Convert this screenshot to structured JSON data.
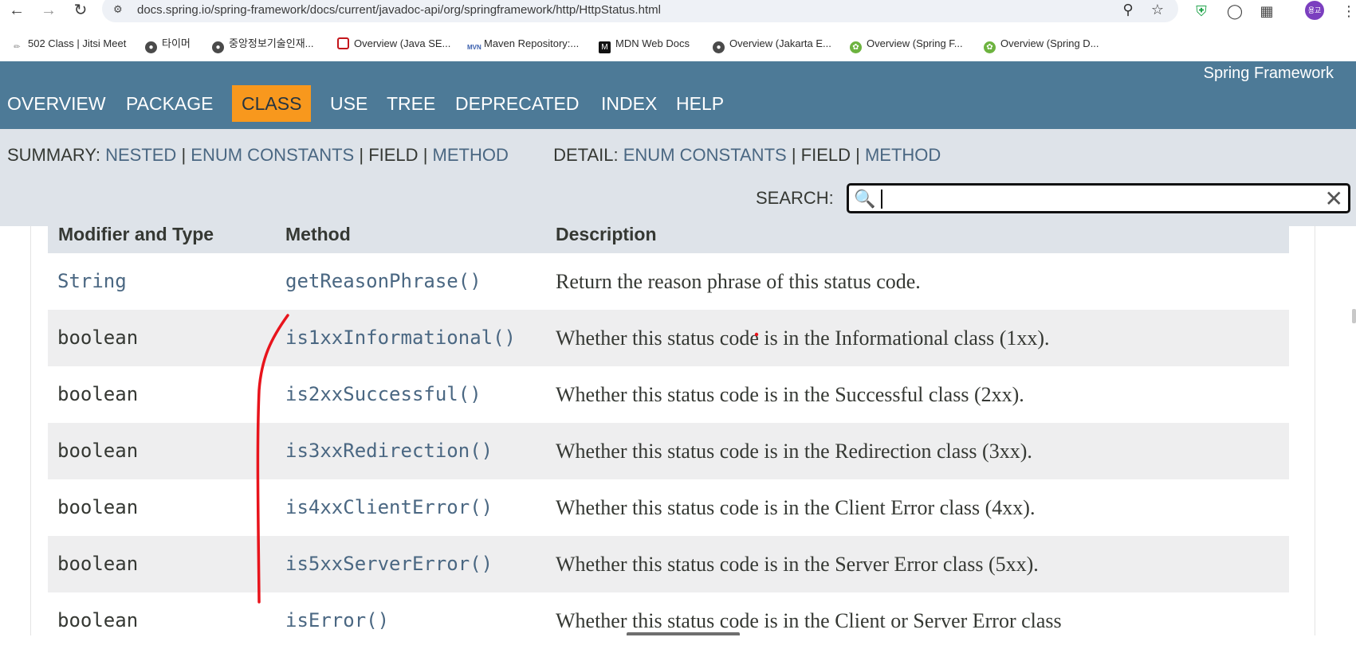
{
  "browser": {
    "url": "docs.spring.io/spring-framework/docs/current/javadoc-api/org/springframework/http/HttpStatus.html",
    "profile_initials": "용교",
    "bookmarks": [
      {
        "label": "502 Class | Jitsi Meet",
        "icon": "jitsi-icon"
      },
      {
        "label": "타이머",
        "icon": "globe-icon"
      },
      {
        "label": "중앙정보기술인재...",
        "icon": "globe-icon"
      },
      {
        "label": "Overview (Java SE...",
        "icon": "oracle-icon"
      },
      {
        "label": "Maven Repository:...",
        "icon": "maven-icon"
      },
      {
        "label": "MDN Web Docs",
        "icon": "mdn-icon"
      },
      {
        "label": "Overview (Jakarta E...",
        "icon": "globe-icon"
      },
      {
        "label": "Overview (Spring F...",
        "icon": "spring-icon"
      },
      {
        "label": "Overview (Spring D...",
        "icon": "spring-icon"
      }
    ]
  },
  "javadoc": {
    "brand": "Spring Framework",
    "nav": [
      "OVERVIEW",
      "PACKAGE",
      "CLASS",
      "USE",
      "TREE",
      "DEPRECATED",
      "INDEX",
      "HELP"
    ],
    "active_nav": "CLASS",
    "summary": {
      "label": "SUMMARY:",
      "nested": "NESTED",
      "enum_constants": "ENUM CONSTANTS",
      "field": "FIELD",
      "method": "METHOD",
      "sep": "|"
    },
    "detail": {
      "label": "DETAIL:",
      "enum_constants": "ENUM CONSTANTS",
      "field": "FIELD",
      "method": "METHOD"
    },
    "search_label": "SEARCH:",
    "search_value": ""
  },
  "method_table": {
    "headers": [
      "Modifier and Type",
      "Method",
      "Description"
    ],
    "rows": [
      {
        "type": "String",
        "method": "getReasonPhrase()",
        "desc": "Return the reason phrase of this status code."
      },
      {
        "type": "boolean",
        "method": "is1xxInformational()",
        "desc": "Whether this status code is in the Informational class (1xx)."
      },
      {
        "type": "boolean",
        "method": "is2xxSuccessful()",
        "desc": "Whether this status code is in the Successful class (2xx)."
      },
      {
        "type": "boolean",
        "method": "is3xxRedirection()",
        "desc": "Whether this status code is in the Redirection class (3xx)."
      },
      {
        "type": "boolean",
        "method": "is4xxClientError()",
        "desc": "Whether this status code is in the Client Error class (4xx)."
      },
      {
        "type": "boolean",
        "method": "is5xxServerError()",
        "desc": "Whether this status code is in the Server Error class (5xx)."
      },
      {
        "type": "boolean",
        "method": "isError()",
        "desc": "Whether this status code is in the Client or Server Error class"
      }
    ]
  },
  "colors": {
    "header_bg": "#4d7a97",
    "active_tab": "#f8981d",
    "subnav_bg": "#dee3e9",
    "link": "#4a6782",
    "annotation": "#e8141c"
  }
}
